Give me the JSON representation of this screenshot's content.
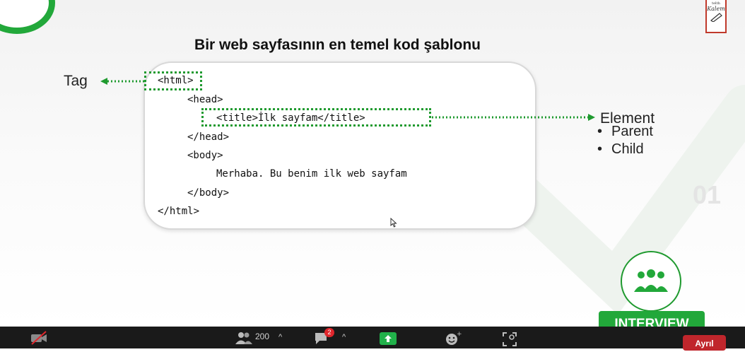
{
  "slide": {
    "title": "Bir web sayfasının en temel kod şablonu",
    "code_lines": [
      "<html>",
      "<head>",
      "<title>İlk sayfam</title>",
      "</head>",
      "<body>",
      "Merhaba. Bu benim ilk web sayfam",
      "</body>",
      "</html>"
    ],
    "tag_label": "Tag",
    "element_label": "Element",
    "bullets": [
      "Parent",
      "Child"
    ],
    "badge_top": "telth",
    "badge_name": "Kalem",
    "interview_label": "INTERVIEW",
    "accent_color": "#1f9a2f"
  },
  "toolbar": {
    "participants_count": "200",
    "chat_badge": "2",
    "leave_label": "Ayrıl",
    "icons": [
      "video-off-icon",
      "participants-icon",
      "chat-icon",
      "share-screen-icon",
      "reactions-icon",
      "apps-icon"
    ]
  }
}
